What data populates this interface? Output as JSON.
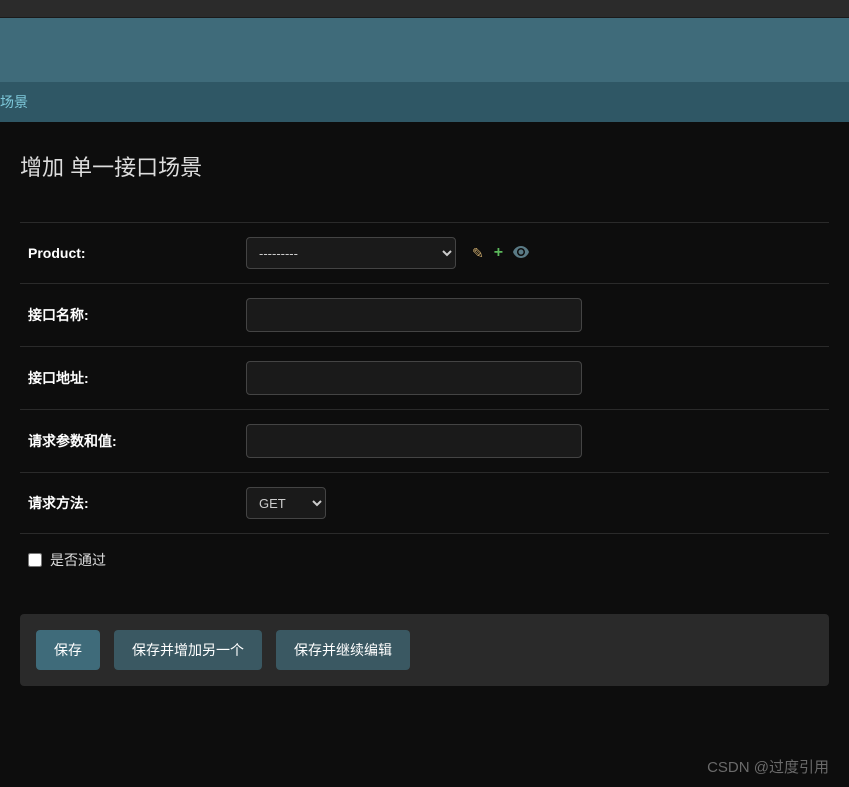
{
  "breadcrumb": {
    "text": "场景"
  },
  "page": {
    "title": "增加 单一接口场景"
  },
  "form": {
    "product": {
      "label": "Product:",
      "selected": "---------"
    },
    "interface_name": {
      "label": "接口名称:",
      "value": ""
    },
    "interface_url": {
      "label": "接口地址:",
      "value": ""
    },
    "request_params": {
      "label": "请求参数和值:",
      "value": ""
    },
    "request_method": {
      "label": "请求方法:",
      "selected": "GET"
    },
    "is_passed": {
      "label": "是否通过"
    }
  },
  "buttons": {
    "save": "保存",
    "save_add_another": "保存并增加另一个",
    "save_continue": "保存并继续编辑"
  },
  "watermark": "CSDN @过度引用"
}
